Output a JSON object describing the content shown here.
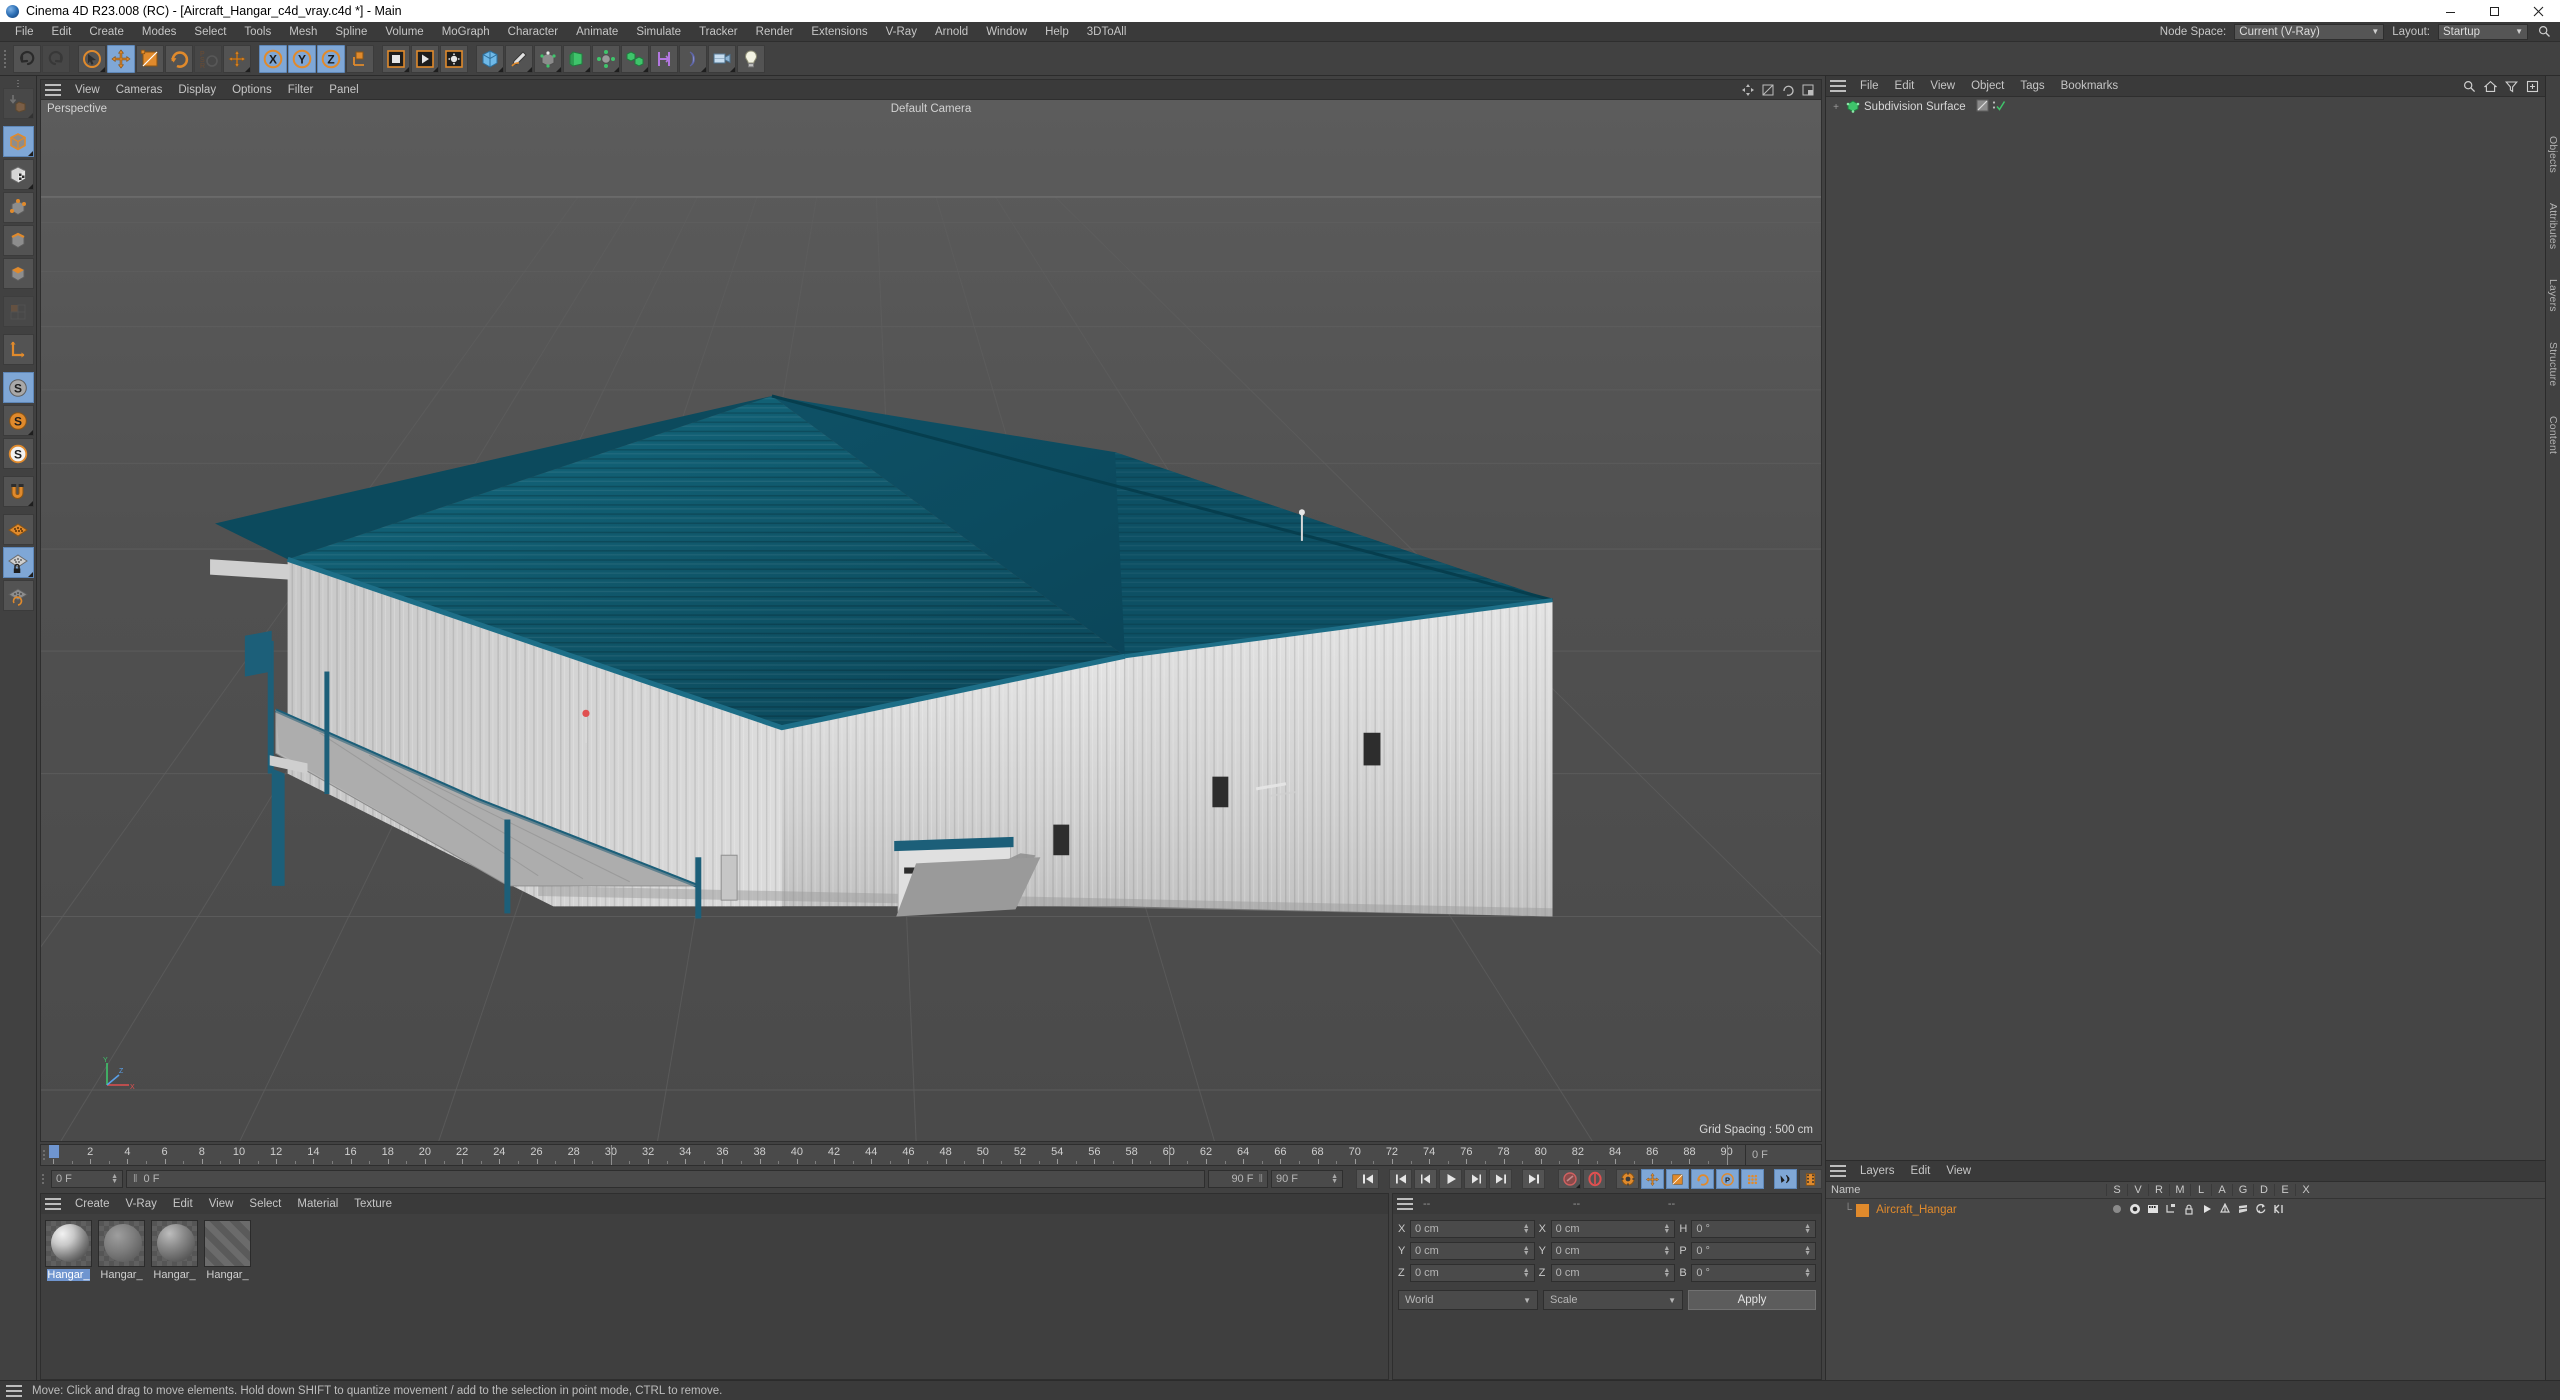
{
  "window": {
    "title": "Cinema 4D R23.008 (RC) - [Aircraft_Hangar_c4d_vray.c4d *] - Main",
    "minimize": "minimize-icon",
    "maximize": "maximize-icon",
    "close": "close-icon"
  },
  "menubar": {
    "items": [
      "File",
      "Edit",
      "Create",
      "Modes",
      "Select",
      "Tools",
      "Mesh",
      "Spline",
      "Volume",
      "MoGraph",
      "Character",
      "Animate",
      "Simulate",
      "Tracker",
      "Render",
      "Extensions",
      "V-Ray",
      "Arnold",
      "Window",
      "Help",
      "3DToAll"
    ],
    "node_space_label": "Node Space:",
    "node_space_value": "Current (V-Ray)",
    "layout_label": "Layout:",
    "layout_value": "Startup",
    "search_icon": "search-icon"
  },
  "toolbar": {
    "groups": [
      {
        "name": "history",
        "buttons": [
          {
            "icon": "undo-icon",
            "label": "Undo",
            "state": "normal"
          },
          {
            "icon": "redo-icon",
            "label": "Redo",
            "state": "disabled"
          }
        ]
      },
      {
        "name": "transform",
        "buttons": [
          {
            "icon": "select-live-icon",
            "label": "Live Selection",
            "state": "normal"
          },
          {
            "icon": "move-icon",
            "label": "Move",
            "state": "selected"
          },
          {
            "icon": "scale-icon",
            "label": "Scale",
            "state": "normal"
          },
          {
            "icon": "rotate-icon",
            "label": "Rotate",
            "state": "normal"
          },
          {
            "icon": "psr-icon",
            "label": "PSR",
            "state": "disabled"
          },
          {
            "icon": "world-axis-icon",
            "label": "World/Object Axis",
            "state": "normal"
          }
        ]
      },
      {
        "name": "axis-lock",
        "buttons": [
          {
            "icon": "axis-x-icon",
            "label": "X Axis",
            "state": "selected"
          },
          {
            "icon": "axis-y-icon",
            "label": "Y Axis",
            "state": "selected"
          },
          {
            "icon": "axis-z-icon",
            "label": "Z Axis",
            "state": "selected"
          },
          {
            "icon": "axis-system-icon",
            "label": "Coordinate System",
            "state": "normal"
          }
        ]
      },
      {
        "name": "render",
        "buttons": [
          {
            "icon": "render-view-icon",
            "label": "Render View",
            "state": "normal"
          },
          {
            "icon": "render-to-picture-icon",
            "label": "Render to Picture Viewer",
            "state": "normal"
          },
          {
            "icon": "render-settings-icon",
            "label": "Edit Render Settings",
            "state": "normal"
          }
        ]
      },
      {
        "name": "create",
        "buttons": [
          {
            "icon": "cube-primitive-icon",
            "label": "Cube",
            "state": "normal"
          },
          {
            "icon": "spline-pen-icon",
            "label": "Pen",
            "state": "normal"
          },
          {
            "icon": "generator-icon",
            "label": "Subdivision Surface",
            "state": "normal"
          },
          {
            "icon": "bend-deformer-icon",
            "label": "Bend",
            "state": "normal"
          },
          {
            "icon": "environment-icon",
            "label": "Floor / Environment",
            "state": "normal"
          },
          {
            "icon": "mograph-cloner-icon",
            "label": "MoGraph Cloner",
            "state": "normal"
          },
          {
            "icon": "field-icon",
            "label": "Field",
            "state": "normal"
          },
          {
            "icon": "deformer-icon",
            "label": "Deformer",
            "state": "normal"
          },
          {
            "icon": "camera-icon",
            "label": "Camera",
            "state": "normal"
          },
          {
            "icon": "light-icon",
            "label": "Light",
            "state": "normal"
          }
        ]
      }
    ]
  },
  "leftbar": {
    "buttons": [
      {
        "icon": "make-editable-icon",
        "label": "Make Editable",
        "state": "disabled"
      },
      {
        "icon": "model-mode-icon",
        "label": "Model Mode",
        "state": "selected"
      },
      {
        "icon": "texture-mode-icon",
        "label": "Texture Mode",
        "state": "normal"
      },
      {
        "icon": "points-mode-icon",
        "label": "Points Mode",
        "state": "normal"
      },
      {
        "icon": "edges-mode-icon",
        "label": "Edges Mode",
        "state": "normal"
      },
      {
        "icon": "polygons-mode-icon",
        "label": "Polygons Mode",
        "state": "normal"
      },
      {
        "icon": "uv-mode-icon",
        "label": "UV Mode",
        "state": "disabled"
      },
      {
        "icon": "axis-mode-icon",
        "label": "Enable Axis",
        "state": "normal"
      },
      {
        "icon": "viewport-solo-off-icon",
        "label": "Viewport Solo Off",
        "state": "selected"
      },
      {
        "icon": "viewport-solo-single-icon",
        "label": "Viewport Solo Single",
        "state": "normal"
      },
      {
        "icon": "viewport-solo-hierarchy-icon",
        "label": "Viewport Solo Hierarchy",
        "state": "normal"
      },
      {
        "icon": "snap-magnet-icon",
        "label": "Enable Snapping",
        "state": "normal"
      },
      {
        "icon": "workplane-icon",
        "label": "Workplane",
        "state": "normal"
      },
      {
        "icon": "lock-workplane-icon",
        "label": "Lock Workplane",
        "state": "selected"
      },
      {
        "icon": "planar-workplane-icon",
        "label": "Planar Workplane",
        "state": "normal"
      }
    ]
  },
  "viewport": {
    "menu_items": [
      "View",
      "Cameras",
      "Display",
      "Options",
      "Filter",
      "Panel"
    ],
    "hamburger_icon": "hamburger-icon",
    "corner_icons": [
      "viewport-move-icon",
      "viewport-scale-icon",
      "viewport-rotate-icon",
      "viewport-maximize-icon"
    ],
    "projection_label": "Perspective",
    "camera_label": "Default Camera",
    "grid_spacing": "Grid Spacing : 500 cm",
    "axis_gizmo": {
      "x": "X",
      "y": "Y",
      "z": "Z"
    },
    "model": {
      "name": "Aircraft Hangar",
      "roof_color": "#0e5266",
      "roof_highlight": "#14697f",
      "wall_color": "#d8d8d8",
      "wall_shadow": "#a9a9a9",
      "trim_color": "#1a5f78",
      "ground_color": "#4e4e4e"
    }
  },
  "timeline": {
    "ticks": [
      0,
      2,
      4,
      6,
      8,
      10,
      12,
      14,
      16,
      18,
      20,
      22,
      24,
      26,
      28,
      30,
      32,
      34,
      36,
      38,
      40,
      42,
      44,
      46,
      48,
      50,
      52,
      54,
      56,
      58,
      60,
      62,
      64,
      66,
      68,
      70,
      72,
      74,
      76,
      78,
      80,
      82,
      84,
      86,
      88,
      90
    ],
    "start_frame": "0 F",
    "current_frame": "0 F",
    "preview_frame": "0 F",
    "end_frame": "90 F",
    "end_frame_2": "90 F",
    "right_frame": "0 F",
    "playhead_frame": 0,
    "marker_frames": [
      30,
      60,
      90
    ],
    "transport": [
      {
        "icon": "goto-start-icon",
        "label": "Go to Start"
      },
      {
        "icon": "prev-key-icon",
        "label": "Go to Previous Key"
      },
      {
        "icon": "prev-frame-icon",
        "label": "Go to Previous Frame"
      },
      {
        "icon": "play-icon",
        "label": "Play Forwards"
      },
      {
        "icon": "next-frame-icon",
        "label": "Go to Next Frame"
      },
      {
        "icon": "next-key-icon",
        "label": "Go to Next Key"
      },
      {
        "icon": "goto-end-icon",
        "label": "Go to End"
      }
    ],
    "record_group": [
      {
        "icon": "record-active-objects-icon",
        "label": "Record Active Objects",
        "state": "disabled"
      },
      {
        "icon": "autokeying-icon",
        "label": "Autokeying",
        "state": "normal"
      },
      {
        "icon": "keyframe-selection-icon",
        "label": "Keyframe Selection",
        "state": "normal"
      },
      {
        "icon": "key-position-icon",
        "label": "Position",
        "state": "selected"
      },
      {
        "icon": "key-scale-icon",
        "label": "Scale",
        "state": "selected"
      },
      {
        "icon": "key-rotation-icon",
        "label": "Rotation",
        "state": "selected"
      },
      {
        "icon": "key-parameter-icon",
        "label": "Parameter",
        "state": "selected"
      },
      {
        "icon": "key-pla-icon",
        "label": "Point Level Animation",
        "state": "selected"
      }
    ],
    "right_group": [
      {
        "icon": "sound-icon",
        "label": "Sound",
        "state": "selected"
      },
      {
        "icon": "frames-icon",
        "label": "Frames",
        "state": "normal"
      }
    ]
  },
  "material_manager": {
    "menu_items": [
      "Create",
      "V-Ray",
      "Edit",
      "View",
      "Select",
      "Material",
      "Texture"
    ],
    "materials": [
      {
        "name": "Hangar_",
        "selected": true
      },
      {
        "name": "Hangar_",
        "selected": false
      },
      {
        "name": "Hangar_",
        "selected": false
      },
      {
        "name": "Hangar_",
        "selected": false
      }
    ]
  },
  "coordinates": {
    "header_dashes": [
      "--",
      "--",
      "--"
    ],
    "position": {
      "label_x": "X",
      "label_y": "Y",
      "label_z": "Z",
      "x": "0 cm",
      "y": "0 cm",
      "z": "0 cm"
    },
    "size": {
      "label_x": "X",
      "label_y": "Y",
      "label_z": "Z",
      "x": "0 cm",
      "y": "0 cm",
      "z": "0 cm"
    },
    "rotation": {
      "label_h": "H",
      "label_p": "P",
      "label_b": "B",
      "h": "0 °",
      "p": "0 °",
      "b": "0 °"
    },
    "system": "World",
    "mode": "Scale",
    "apply_label": "Apply"
  },
  "object_manager": {
    "menu_items": [
      "File",
      "Edit",
      "View",
      "Object",
      "Tags",
      "Bookmarks"
    ],
    "tools": [
      "search-icon",
      "home-icon",
      "filter-icon",
      "add-layer-icon"
    ],
    "objects": [
      {
        "name": "Subdivision Surface",
        "expand": "+",
        "icon": "subdivision-surface-icon",
        "tags": [
          "texture-tag-icon",
          "visibility-check-icon"
        ]
      }
    ]
  },
  "layer_manager": {
    "menu_items": [
      "Layers",
      "Edit",
      "View"
    ],
    "columns": [
      "Name",
      "S",
      "V",
      "R",
      "M",
      "L",
      "A",
      "G",
      "D",
      "E",
      "X"
    ],
    "layers": [
      {
        "name": "Aircraft_Hangar",
        "color": "#e08a2c",
        "icons": [
          "solo-icon",
          "view-icon",
          "render-icon",
          "manager-icon",
          "lock-icon",
          "animation-icon",
          "generators-icon",
          "deformers-icon",
          "expressions-icon",
          "xref-icon"
        ]
      }
    ]
  },
  "right_rail": {
    "tabs": [
      "Objects",
      "Attributes",
      "Layers",
      "Structure",
      "Content"
    ]
  },
  "statusbar": {
    "hamburger_icon": "hamburger-icon",
    "message": "Move: Click and drag to move elements. Hold down SHIFT to quantize movement / add to the selection in point mode, CTRL to remove."
  }
}
